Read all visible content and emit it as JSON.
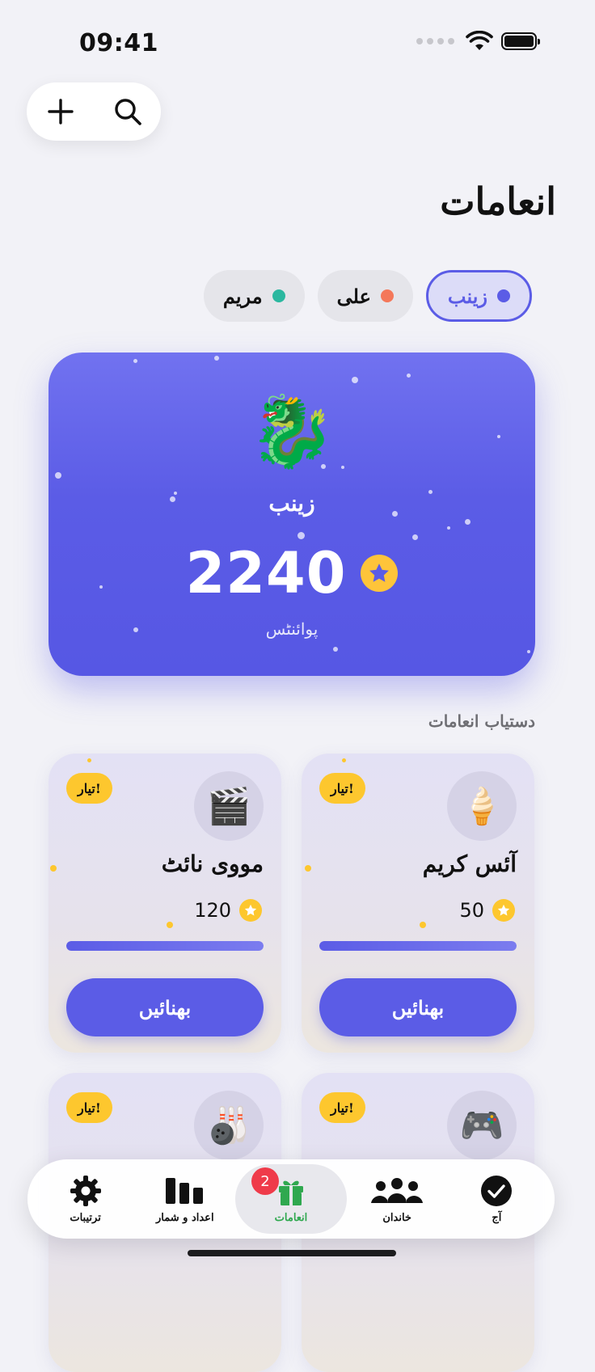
{
  "status": {
    "time": "09:41"
  },
  "top_actions": {
    "add_icon": "plus-icon",
    "search_icon": "search-icon"
  },
  "page": {
    "title": "انعامات"
  },
  "kids": [
    {
      "name": "زینب",
      "color": "#5b5ce6",
      "selected": true
    },
    {
      "name": "علی",
      "color": "#f4785a",
      "selected": false
    },
    {
      "name": "مریم",
      "color": "#2bb8a0",
      "selected": false
    }
  ],
  "hero": {
    "emoji": "🐉",
    "name": "زینب",
    "points": "2240",
    "unit": "پوائنٹس"
  },
  "section": {
    "title": "دستیاب انعامات"
  },
  "rewards": [
    {
      "name": "آئس کریم",
      "emoji": "🍦",
      "cost": "50",
      "badge": "تیار!",
      "button": "بھنائیں",
      "progress": 1.0
    },
    {
      "name": "مووی نائٹ",
      "emoji": "🎬",
      "cost": "120",
      "badge": "تیار!",
      "button": "بھنائیں",
      "progress": 1.0
    },
    {
      "name": "",
      "emoji": "🎮",
      "cost": "",
      "badge": "تیار!",
      "button": "",
      "progress": 1.0
    },
    {
      "name": "",
      "emoji": "🎳",
      "cost": "",
      "badge": "تیار!",
      "button": "",
      "progress": 1.0
    }
  ],
  "tabbar": {
    "today": "آج",
    "family": "خاندان",
    "rewards": "انعامات",
    "rewards_badge": "2",
    "stats": "اعداد و شمار",
    "settings": "ترتیبات"
  },
  "colors": {
    "accent": "#5b5ce6",
    "gold": "#fdc72e",
    "active_tab": "#2fa84f",
    "badge_red": "#ef3b4a"
  }
}
